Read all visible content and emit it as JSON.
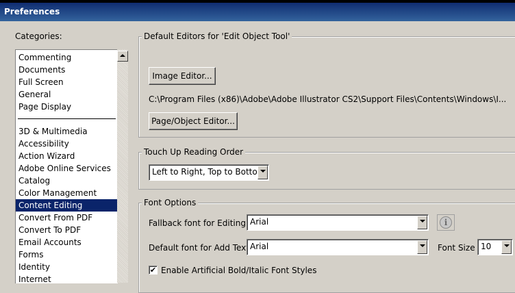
{
  "window": {
    "title": "Preferences"
  },
  "categories": {
    "label": "Categories:",
    "group1": [
      "Commenting",
      "Documents",
      "Full Screen",
      "General",
      "Page Display"
    ],
    "group2": [
      "3D & Multimedia",
      "Accessibility",
      "Action Wizard",
      "Adobe Online Services",
      "Catalog",
      "Color Management",
      "Content Editing",
      "Convert From PDF",
      "Convert To PDF",
      "Email Accounts",
      "Forms",
      "Identity",
      "Internet"
    ],
    "selected": "Content Editing"
  },
  "editors": {
    "legend": "Default Editors for 'Edit Object Tool'",
    "image_editor_button": "Image Editor...",
    "image_editor_path": "C:\\Program Files (x86)\\Adobe\\Adobe Illustrator CS2\\Support Files\\Contents\\Windows\\I...",
    "page_object_editor_button": "Page/Object Editor..."
  },
  "reading_order": {
    "legend": "Touch Up Reading Order",
    "value": "Left to Right, Top to Bottom"
  },
  "font_options": {
    "legend": "Font Options",
    "fallback_label": "Fallback font for Editing",
    "fallback_value": "Arial",
    "default_label": "Default font for Add Text",
    "default_value": "Arial",
    "size_label": "Font Size",
    "size_value": "10",
    "artificial_label": "Enable Artificial Bold/Italic Font Styles",
    "artificial_checked": true
  }
}
